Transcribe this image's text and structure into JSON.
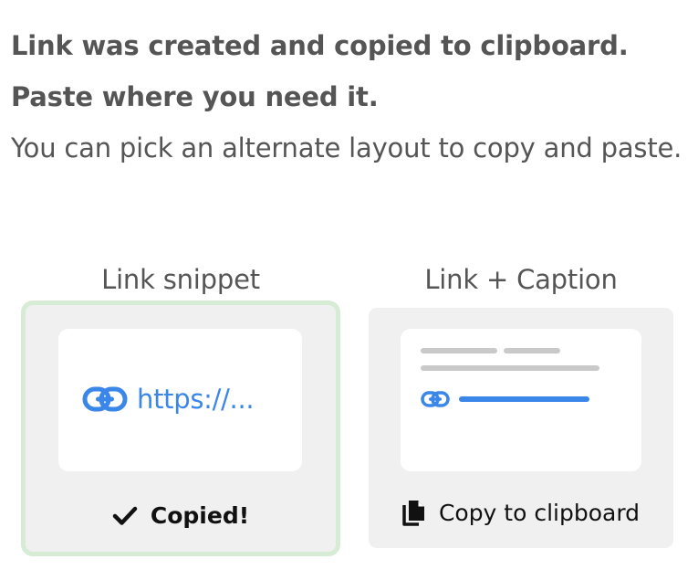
{
  "message": {
    "headline": "Link was created and copied to clipboard. Paste where you need it.",
    "subtext": "You can pick an alternate layout to copy and paste."
  },
  "options": [
    {
      "title": "Link snippet",
      "preview_text": "https://...",
      "action_label": "Copied!",
      "action_icon": "checkmark-icon",
      "preview_icon": "link-icon",
      "selected": true
    },
    {
      "title": "Link + Caption",
      "action_label": "Copy to clipboard",
      "action_icon": "copy-icon",
      "preview_icon": "link-icon",
      "selected": false
    }
  ],
  "colors": {
    "link_blue": "#3a86e9",
    "selected_border": "#d6ecd4",
    "card_bg": "#f0f0f0",
    "text_gray": "#555555"
  }
}
